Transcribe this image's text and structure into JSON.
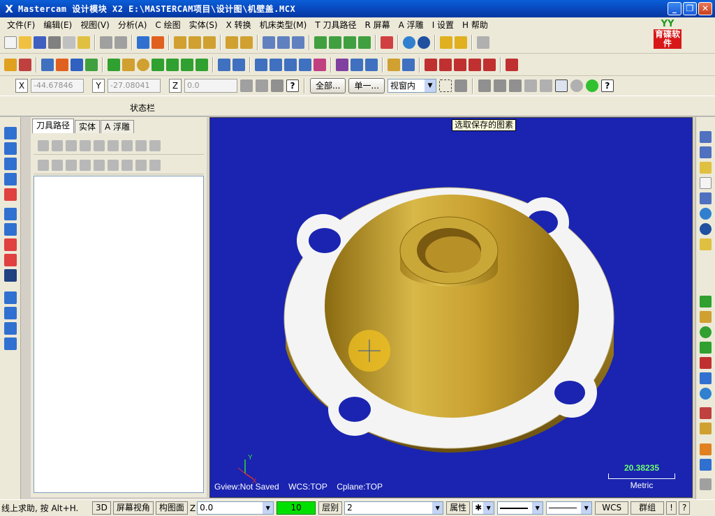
{
  "window": {
    "title": "Mastercam 设计模块  X2  E:\\MASTERCAM项目\\设计图\\机壁盖.MCX",
    "controls": [
      "_",
      "❐",
      "✕"
    ]
  },
  "logo": {
    "top": "YY",
    "bottom": "育碟软件"
  },
  "menu": [
    "文件(F)",
    "编辑(E)",
    "视图(V)",
    "分析(A)",
    "C 绘图",
    "实体(S)",
    "X 转换",
    "机床类型(M)",
    "T 刀具路径",
    "R 屏幕",
    "A 浮雕",
    "I 设置",
    "H 帮助"
  ],
  "coords": {
    "x_label": "X",
    "x_value": "-44.67846",
    "y_label": "Y",
    "y_value": "-27.08041",
    "z_label": "Z",
    "z_value": "0.0",
    "all_button": "全部...",
    "single_button": "单一...",
    "view_select": "视窗内"
  },
  "status_strip_label": "状态栏",
  "manager": {
    "tabs": [
      "刀具路径",
      "实体",
      "A 浮雕"
    ]
  },
  "viewport": {
    "tooltip": "选取保存的图素",
    "gview": "Gview:Not Saved",
    "wcs": "WCS:TOP",
    "cplane": "Cplane:TOP",
    "scale_value": "20.38235",
    "scale_unit": "Metric",
    "axis_x": "X",
    "axis_y": "Y",
    "colors": {
      "background": "#1a24b0",
      "part_gold": "#c8a030",
      "flange_white": "#f4f4f4"
    }
  },
  "bottom": {
    "hint": "线上求助, 按 Alt+H.",
    "btn_3d": "3D",
    "btn_screen_view": "屏幕视角",
    "btn_plane": "构图面",
    "z_label": "Z",
    "z_value": "0.0",
    "level_value": "10",
    "layer_label": "层别",
    "layer_value": "2",
    "attr_button": "属性",
    "wcs_button": "WCS",
    "group_button": "群组",
    "excl_button": "!",
    "help_button": "?"
  }
}
